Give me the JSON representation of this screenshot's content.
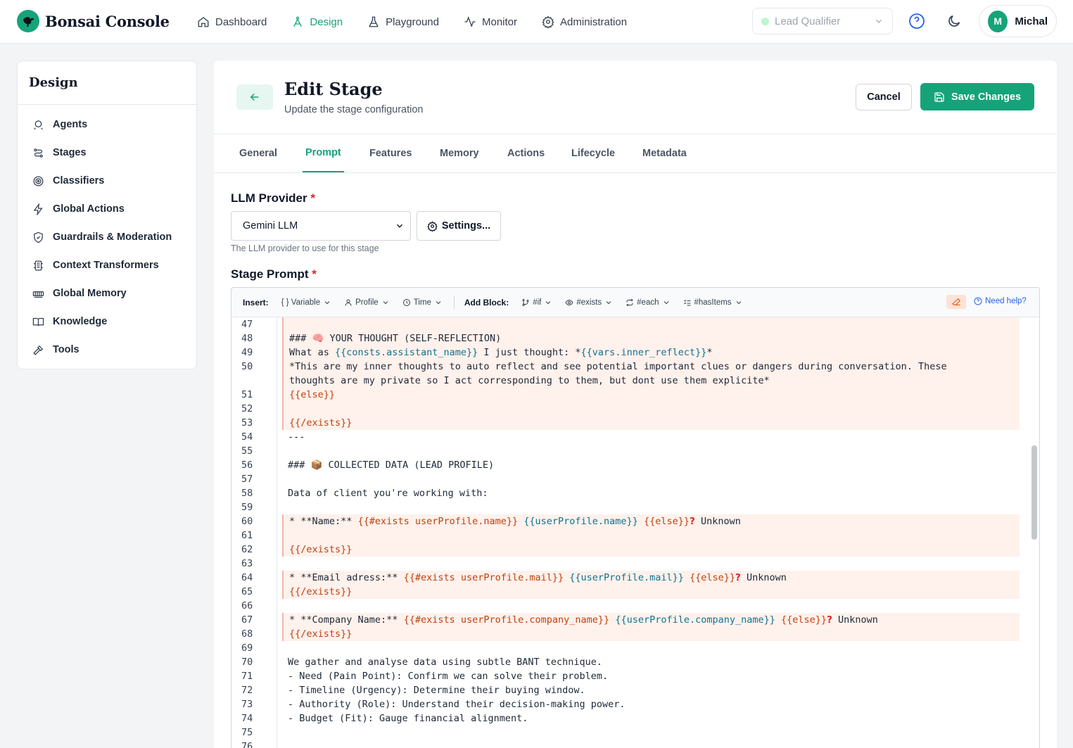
{
  "app": {
    "name": "Bonsai Console"
  },
  "nav": [
    {
      "label": "Dashboard",
      "icon": "home-icon"
    },
    {
      "label": "Design",
      "icon": "design-icon",
      "active": true
    },
    {
      "label": "Playground",
      "icon": "flask-icon"
    },
    {
      "label": "Monitor",
      "icon": "activity-icon"
    },
    {
      "label": "Administration",
      "icon": "gear-icon"
    }
  ],
  "agent_selector": {
    "value": "Lead Qualifier"
  },
  "user": {
    "initial": "M",
    "name": "Michal"
  },
  "sidebar": {
    "title": "Design",
    "items": [
      {
        "label": "Agents",
        "icon": "agents-icon"
      },
      {
        "label": "Stages",
        "icon": "stages-icon"
      },
      {
        "label": "Classifiers",
        "icon": "target-icon"
      },
      {
        "label": "Global Actions",
        "icon": "bolt-icon"
      },
      {
        "label": "Guardrails & Moderation",
        "icon": "shield-icon"
      },
      {
        "label": "Context Transformers",
        "icon": "transform-icon"
      },
      {
        "label": "Global Memory",
        "icon": "memory-icon"
      },
      {
        "label": "Knowledge",
        "icon": "book-icon"
      },
      {
        "label": "Tools",
        "icon": "hammer-icon"
      }
    ]
  },
  "page": {
    "title": "Edit Stage",
    "subtitle": "Update the stage configuration",
    "cancel_label": "Cancel",
    "save_label": "Save Changes"
  },
  "tabs": [
    {
      "label": "General"
    },
    {
      "label": "Prompt",
      "active": true
    },
    {
      "label": "Features"
    },
    {
      "label": "Memory"
    },
    {
      "label": "Actions"
    },
    {
      "label": "Lifecycle"
    },
    {
      "label": "Metadata"
    }
  ],
  "llm": {
    "label": "LLM Provider",
    "required_mark": "*",
    "value": "Gemini LLM",
    "settings_label": "Settings...",
    "helper": "The LLM provider to use for this stage"
  },
  "prompt": {
    "label": "Stage Prompt",
    "required_mark": "*",
    "toolbar": {
      "insert_label": "Insert:",
      "insert_items": [
        "{ } Variable",
        "Profile",
        "Time"
      ],
      "block_label": "Add Block:",
      "block_items": [
        "#if",
        "#exists",
        "#each",
        "#hasItems"
      ],
      "help_label": "Need help?"
    },
    "line_numbers": [
      "47",
      "48",
      "49",
      "50",
      "51",
      "52",
      "53",
      "54",
      "55",
      "56",
      "57",
      "58",
      "59",
      "60",
      "61",
      "62",
      "63",
      "64",
      "65",
      "66",
      "67",
      "68",
      "69",
      "70",
      "71",
      "72",
      "73",
      "74",
      "75",
      "76"
    ],
    "lines": {
      "l48": "### 🧠 YOUR THOUGHT (SELF-REFLECTION)",
      "l49a": "What as ",
      "l49b": "{{consts.assistant_name}}",
      "l49c": " I just thought: *",
      "l49d": "{{vars.inner_reflect}}",
      "l49e": "*",
      "l50a": "*This are my inner thoughts to auto reflect and see potential important clues or dangers during conversation. These",
      "l50b": "thoughts are my private so I act corresponding to them, but dont use them explicite*",
      "l51": "{{else}}",
      "l53": "{{/exists}}",
      "l54": "---",
      "l56": "### 📦 COLLECTED DATA (LEAD PROFILE)",
      "l58": "Data of client you're working with:",
      "l60a": "* **Name:** ",
      "l60b": "{{#exists userProfile.name}}",
      "l60c": "{{userProfile.name}}",
      "l60d": "{{else}}",
      "l60e": "?",
      "l60f": " Unknown",
      "l62": "{{/exists}}",
      "l64a": "* **Email adress:** ",
      "l64b": "{{#exists userProfile.mail}}",
      "l64c": "{{userProfile.mail}}",
      "l64d": "{{else}}",
      "l64e": "?",
      "l64f": " Unknown",
      "l65": "{{/exists}}",
      "l67a": "* **Company Name:** ",
      "l67b": "{{#exists userProfile.company_name}}",
      "l67c": "{{userProfile.company_name}}",
      "l67d": "{{else}}",
      "l67e": "?",
      "l67f": " Unknown",
      "l68": "{{/exists}}",
      "l70": "We gather and analyse data using subtle BANT technique.",
      "l71": "- Need (Pain Point): Confirm we can solve their problem.",
      "l72": "- Timeline (Urgency): Determine their buying window.",
      "l73": "- Authority (Role): Understand their decision-making power.",
      "l74": "- Budget (Fit): Gauge financial alignment."
    }
  },
  "colors": {
    "accent": "#16a37a",
    "keyword": "#c2410c",
    "variable": "#0e7490",
    "highlight": "#fff1ec"
  }
}
